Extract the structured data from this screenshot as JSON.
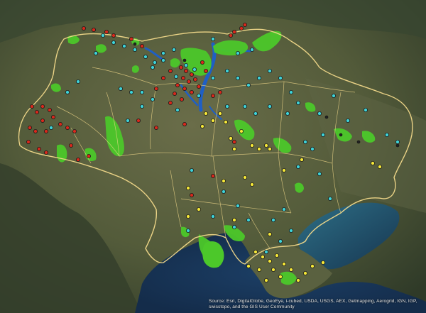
{
  "map": {
    "basemap": "satellite imagery",
    "region": "Ukraine",
    "colors": {
      "land_dark": "#3e4a30",
      "land_light": "#6b6e4c",
      "sea": "#1e3b5c",
      "sea_shallow": "#2f6a88",
      "border": "#f2d98a",
      "protected_area": "#4cc82a",
      "water": "#1f5fc4"
    }
  },
  "legend_marker_colors": {
    "red": "#d8291c",
    "cyan": "#3ed3d8",
    "yellow": "#f5e838"
  },
  "attribution": {
    "text": "Source: Esri, DigitalGlobe, GeoEye, i-cubed, USDA, USGS, AEX, Getmapping, Aerogrid, IGN, IGP, swisstopo, and the GIS User Community"
  }
}
